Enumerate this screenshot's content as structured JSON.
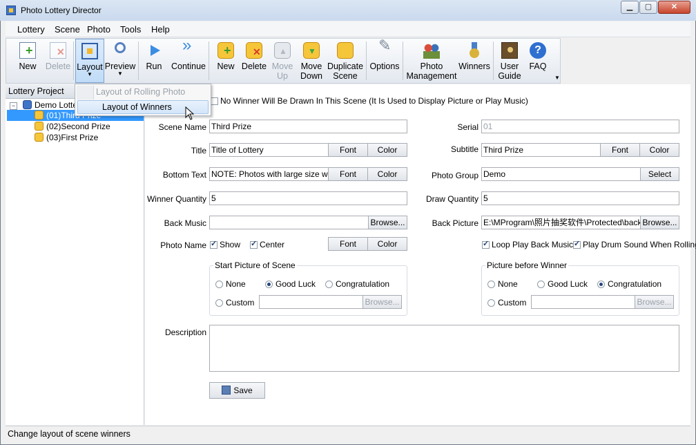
{
  "window": {
    "title": "Photo Lottery Director"
  },
  "menubar": [
    "Lottery",
    "Scene",
    "Photo",
    "Tools",
    "Help"
  ],
  "toolbar": {
    "new": "New",
    "delete": "Delete",
    "layout": "Layout",
    "preview": "Preview",
    "run": "Run",
    "continue": "Continue",
    "scene_new": "New",
    "scene_delete": "Delete",
    "move_up": [
      "Move",
      "Up"
    ],
    "move_down": [
      "Move",
      "Down"
    ],
    "duplicate": [
      "Duplicate",
      "Scene"
    ],
    "options": "Options",
    "photo_management": [
      "Photo",
      "Management"
    ],
    "winners": "Winners",
    "user_guide": [
      "User",
      "Guide"
    ],
    "faq": "FAQ"
  },
  "layout_menu": {
    "items": [
      "Layout of Rolling Photo",
      "Layout of Winners"
    ]
  },
  "tree": {
    "header": "Lottery Project",
    "root": "Demo Lotter",
    "items": [
      "(01)Third Prize",
      "(02)Second Prize",
      "(03)First Prize"
    ]
  },
  "form": {
    "no_winner_label": "No Winner Will Be Drawn In This Scene   (It Is Used to Display Picture or Play Music)",
    "scene_name_label": "Scene Name",
    "scene_name": "Third Prize",
    "serial_label": "Serial",
    "serial": "01",
    "title_label": "Title",
    "title": "Title of Lottery",
    "subtitle_label": "Subtitle",
    "subtitle": "Third Prize",
    "bottom_text_label": "Bottom Text",
    "bottom_text": "NOTE: Photos with large size will ma",
    "photo_group_label": "Photo Group",
    "photo_group": "Demo",
    "winner_quantity_label": "Winner Quantity",
    "winner_quantity": "5",
    "draw_quantity_label": "Draw Quantity",
    "draw_quantity": "5",
    "back_music_label": "Back Music",
    "back_music": "",
    "back_picture_label": "Back Picture",
    "back_picture": "E:\\MProgram\\照片抽奖软件\\Protected\\back.jp",
    "photo_name_label": "Photo Name",
    "show_label": "Show",
    "center_label": "Center",
    "loop_music_label": "Loop Play Back Music",
    "drum_sound_label": "Play Drum Sound When Rolling P",
    "font": "Font",
    "color": "Color",
    "select": "Select",
    "browse": "Browse...",
    "start_picture_title": "Start Picture of Scene",
    "picture_before_title": "Picture before Winner",
    "none": "None",
    "good_luck": "Good Luck",
    "congratulation": "Congratulation",
    "custom": "Custom",
    "description_label": "Description",
    "save": "Save"
  },
  "status": "Change layout of scene winners"
}
